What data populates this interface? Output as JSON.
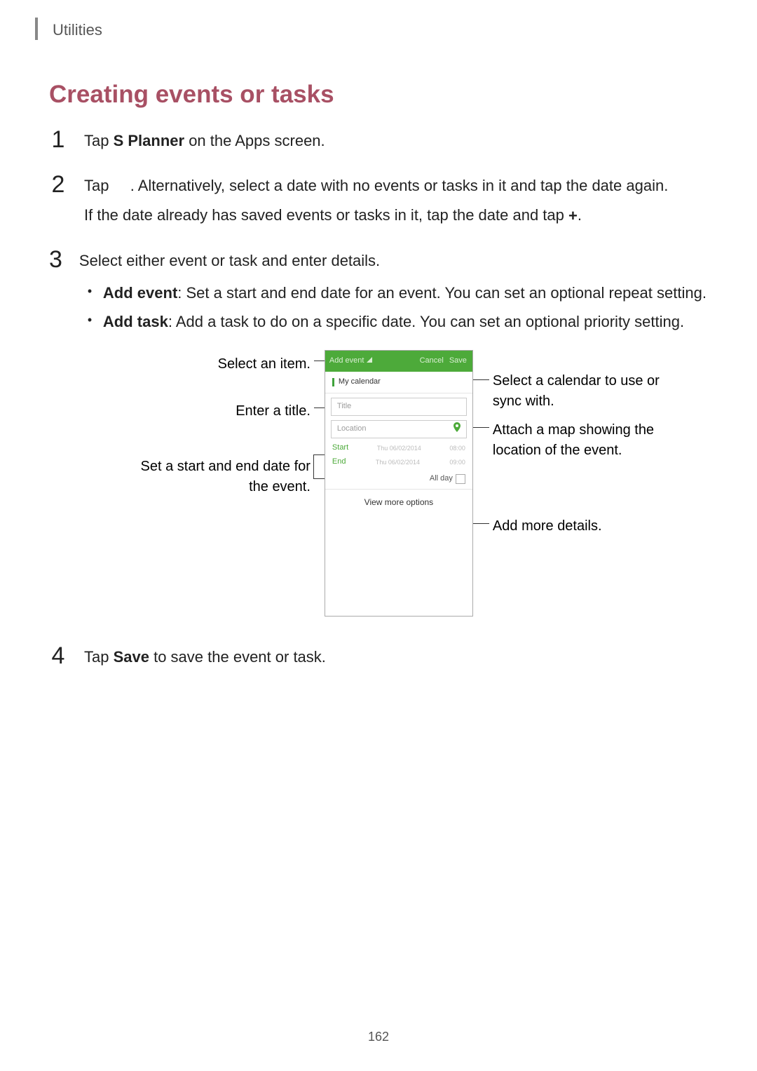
{
  "header": {
    "section": "Utilities"
  },
  "h2": "Creating events or tasks",
  "steps": {
    "s1_text_a": "Tap ",
    "s1_bold": "S Planner",
    "s1_text_b": " on the Apps screen.",
    "s2_line1_a": "Tap ",
    "s2_line1_b": ". Alternatively, select a date with no events or tasks in it and tap the date again.",
    "s2_line2_a": "If the date already has saved events or tasks in it, tap the date and tap ",
    "s2_line2_b": ".",
    "s3_intro": "Select either event or task and enter details.",
    "s3_b1_bold": "Add event",
    "s3_b1_text": ": Set a start and end date for an event. You can set an optional repeat setting.",
    "s3_b2_bold": "Add task",
    "s3_b2_text": ": Add a task to do on a specific date. You can set an optional priority setting.",
    "s4_a": "Tap ",
    "s4_bold": "Save",
    "s4_b": " to save the event or task."
  },
  "callouts": {
    "select_item": "Select an item.",
    "enter_title": "Enter a title.",
    "set_dates": "Set a start and end date for the event.",
    "select_cal": "Select a calendar to use or sync with.",
    "attach_map": "Attach a map showing the location of the event.",
    "add_details": "Add more details."
  },
  "screenshot": {
    "tab_label": "Add event",
    "cancel": "Cancel",
    "save": "Save",
    "my_calendar": "My calendar",
    "title_placeholder": "Title",
    "location_placeholder": "Location",
    "start_label": "Start",
    "start_date": "Thu 06/02/2014",
    "start_time": "08:00",
    "end_label": "End",
    "end_date": "Thu 06/02/2014",
    "end_time": "09:00",
    "all_day": "All day",
    "view_more": "View more options"
  },
  "page_number": "162"
}
